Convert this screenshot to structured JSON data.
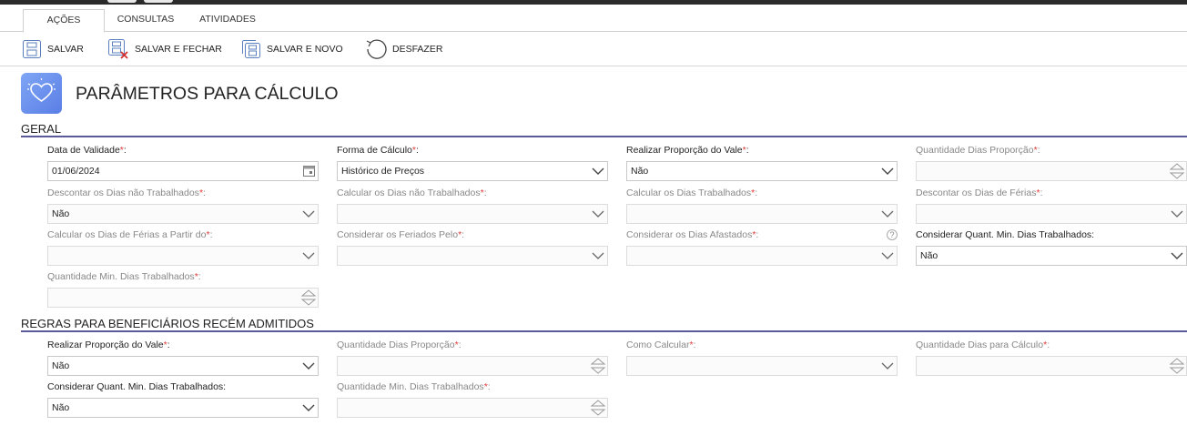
{
  "tabs": [
    "AÇÕES",
    "CONSULTAS",
    "ATIVIDADES"
  ],
  "toolbar": {
    "save": "SALVAR",
    "save_close": "SALVAR E FECHAR",
    "save_new": "SALVAR E NOVO",
    "undo": "DESFAZER"
  },
  "page": {
    "title": "PARÂMETROS PARA CÁLCULO",
    "icon": "heart-icon"
  },
  "sections": {
    "geral": {
      "title": "GERAL",
      "fields": {
        "data_validade": {
          "label": "Data de Validade",
          "value": "01/06/2024"
        },
        "forma_calculo": {
          "label": "Forma de Cálculo",
          "value": "Histórico de Preços"
        },
        "realizar_proporcao": {
          "label": "Realizar Proporção do Vale",
          "value": "Não"
        },
        "qtd_dias_proporcao": {
          "label": "Quantidade Dias Proporção",
          "value": ""
        },
        "descontar_nao_trab": {
          "label": "Descontar os Dias não Trabalhados",
          "value": "Não"
        },
        "calcular_nao_trab": {
          "label": "Calcular os Dias não Trabalhados",
          "value": ""
        },
        "calcular_trab": {
          "label": "Calcular os Dias Trabalhados",
          "value": ""
        },
        "descontar_ferias": {
          "label": "Descontar os Dias de Férias",
          "value": ""
        },
        "calcular_ferias_partir": {
          "label": "Calcular os Dias de Férias a Partir do",
          "value": ""
        },
        "considerar_feriados": {
          "label": "Considerar os Feriados Pelo",
          "value": ""
        },
        "considerar_afastados": {
          "label": "Considerar os Dias Afastados",
          "value": "",
          "help": "?"
        },
        "considerar_qtd_min": {
          "label": "Considerar Quant. Min. Dias Trabalhados:",
          "value": "Não"
        },
        "qtd_min_dias": {
          "label": "Quantidade Min. Dias Trabalhados",
          "value": ""
        }
      }
    },
    "regras": {
      "title": "REGRAS PARA BENEFICIÁRIOS RECÉM ADMITIDOS",
      "fields": {
        "realizar_proporcao": {
          "label": "Realizar Proporção do Vale",
          "value": "Não"
        },
        "qtd_dias_proporcao": {
          "label": "Quantidade Dias Proporção",
          "value": ""
        },
        "como_calcular": {
          "label": "Como Calcular",
          "value": ""
        },
        "qtd_dias_calculo": {
          "label": "Quantidade Dias para Cálculo",
          "value": ""
        },
        "considerar_qtd_min": {
          "label": "Considerar Quant. Min. Dias Trabalhados:",
          "value": "Não"
        },
        "qtd_min_dias": {
          "label": "Quantidade Min. Dias Trabalhados",
          "value": ""
        }
      }
    }
  },
  "required_mark": "*",
  "label_suffix": ":",
  "colors": {
    "required": "#e23b3b",
    "section_rule": "#5a5a9a",
    "icon_bg": "#6b8ff0"
  }
}
